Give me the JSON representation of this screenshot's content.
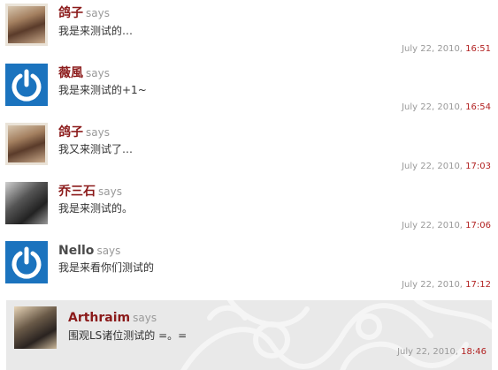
{
  "comments": [
    {
      "author": "鸽子",
      "says": "says",
      "text": "我是来测试的…",
      "date": "July 22, 2010,",
      "time": "16:51",
      "avatar": "photo-avatar"
    },
    {
      "author": "薇風",
      "says": "says",
      "text": "我是来测试的+1~",
      "date": "July 22, 2010,",
      "time": "16:54",
      "avatar": "power-icon"
    },
    {
      "author": "鸽子",
      "says": "says",
      "text": "我又来测试了…",
      "date": "July 22, 2010,",
      "time": "17:03",
      "avatar": "photo-avatar"
    },
    {
      "author": "乔三石",
      "says": "says",
      "text": "我是来测试的。",
      "date": "July 22, 2010,",
      "time": "17:06",
      "avatar": "photo-avatar"
    },
    {
      "author": "Nello",
      "says": "says",
      "text": "我是来看你们测试的",
      "date": "July 22, 2010,",
      "time": "17:12",
      "avatar": "power-icon"
    },
    {
      "author": "Arthraim",
      "says": "says",
      "text": "围观LS诸位测试的 =。=",
      "date": "July 22, 2010,",
      "time": "18:46",
      "avatar": "photo-avatar"
    }
  ],
  "colors": {
    "author": "#8b1a1a",
    "time": "#b22222",
    "avatar_blue": "#1b73be",
    "highlight_bg": "#e9e9e9"
  }
}
